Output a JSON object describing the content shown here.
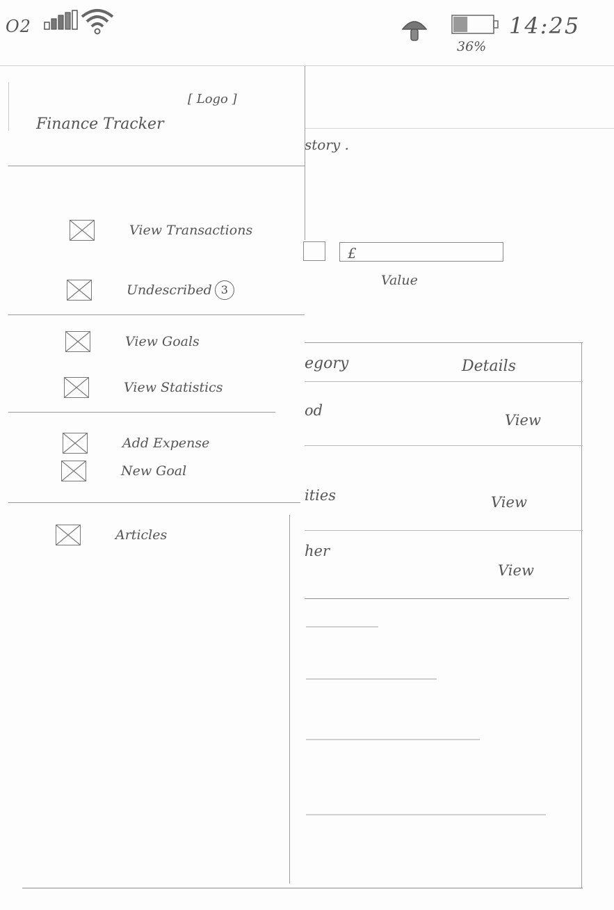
{
  "status_bar": {
    "carrier": "O2",
    "battery_percent": "36%",
    "battery_level": 0.36,
    "time": "14:25",
    "icons": [
      "signal-bars-icon",
      "wifi-icon",
      "mushroom-icon",
      "battery-icon"
    ]
  },
  "background_screen": {
    "heading_fragment": "story .",
    "currency_symbol": "£",
    "value_label": "Value",
    "table": {
      "headers": [
        "egory",
        "Details"
      ],
      "rows": [
        {
          "category": "od",
          "action": "View"
        },
        {
          "category": "ities",
          "action": "View"
        },
        {
          "category": "her",
          "action": "View"
        }
      ]
    }
  },
  "drawer": {
    "logo": "[ Logo ]",
    "title": "Finance Tracker",
    "items": [
      {
        "label": "View Transactions",
        "icon": "x-box-icon"
      },
      {
        "label": "Undescribed",
        "badge": "3",
        "icon": "x-box-icon"
      },
      {
        "label": "View Goals",
        "icon": "x-box-icon"
      },
      {
        "label": "View Statistics",
        "icon": "x-box-icon"
      },
      {
        "label": "Add Expense",
        "icon": "x-box-icon"
      },
      {
        "label": "New Goal",
        "icon": "x-box-icon"
      },
      {
        "label": "Articles",
        "icon": "x-box-icon"
      }
    ]
  }
}
